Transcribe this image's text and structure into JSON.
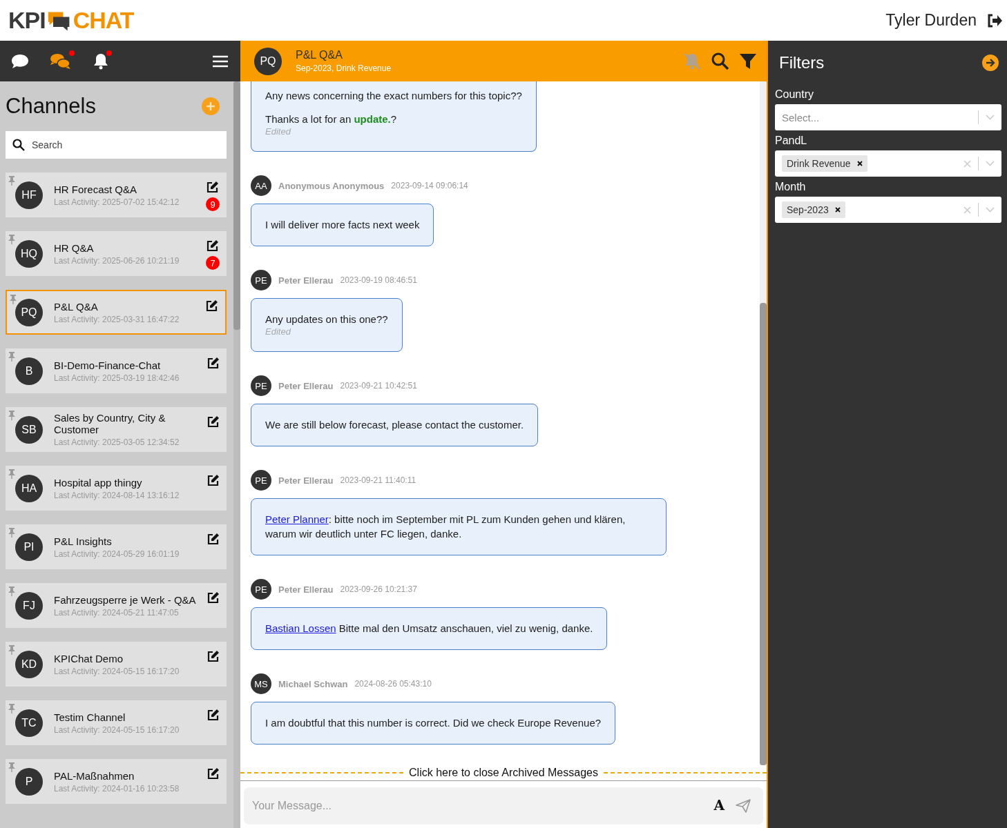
{
  "app": {
    "logo_left": "KPI",
    "logo_right": "CHAT",
    "user": "Tyler Durden"
  },
  "nav": [
    {
      "kind": "chat",
      "selected": false,
      "alert": false
    },
    {
      "kind": "chats",
      "selected": true,
      "alert": true
    },
    {
      "kind": "bell",
      "selected": false,
      "alert": true
    }
  ],
  "channels_title": "Channels",
  "search": {
    "placeholder": "Search"
  },
  "channels": [
    {
      "initials": "HF",
      "name": "HR Forecast Q&A",
      "activity": "Last Activity: 2025-07-02 15:42:12",
      "unread": "9",
      "selected": false
    },
    {
      "initials": "HQ",
      "name": "HR Q&A",
      "activity": "Last Activity: 2025-06-26 10:21:19",
      "unread": "7",
      "selected": false
    },
    {
      "initials": "PQ",
      "name": "P&L Q&A",
      "activity": "Last Activity: 2025-03-31 16:47:22",
      "selected": true
    },
    {
      "initials": "B",
      "name": "BI-Demo-Finance-Chat",
      "activity": "Last Activity: 2025-03-19 18:42:46",
      "selected": false
    },
    {
      "initials": "SB",
      "name": "Sales by Country, City & Customer",
      "activity": "Last Activity: 2025-03-05 12:34:52",
      "selected": false
    },
    {
      "initials": "HA",
      "name": "Hospital app thingy",
      "activity": "Last Activity: 2024-08-14 13:16:12",
      "selected": false
    },
    {
      "initials": "PI",
      "name": "P&L Insights",
      "activity": "Last Activity: 2024-05-29 16:01:19",
      "selected": false
    },
    {
      "initials": "FJ",
      "name": "Fahrzeugsperre je Werk - Q&A",
      "activity": "Last Activity: 2024-05-21 11:47:05",
      "selected": false
    },
    {
      "initials": "KD",
      "name": "KPIChat Demo",
      "activity": "Last Activity: 2024-05-15 16:17:20",
      "selected": false
    },
    {
      "initials": "TC",
      "name": "Testim Channel",
      "activity": "Last Activity: 2024-05-15 16:17:20",
      "selected": false
    },
    {
      "initials": "P",
      "name": "PAL-Maßnahmen",
      "activity": "Last Activity: 2024-01-16 10:23:58",
      "selected": false
    }
  ],
  "chat": {
    "initials": "PQ",
    "title": "P&L Q&A",
    "subtitle": "Sep-2023, Drink Revenue",
    "muted": true
  },
  "messages": [
    {
      "paragraphs": [
        [
          {
            "kind": "text",
            "text": "Any news concerning the exact numbers for this topic??"
          }
        ],
        [
          {
            "kind": "text",
            "text": "Thanks a lot for an **update.**?"
          }
        ]
      ],
      "edited": "Edited"
    },
    {
      "initials": "AA",
      "author": "Anonymous Anonymous",
      "time": "2023-09-14 09:06:14",
      "paragraphs": [
        [
          {
            "kind": "text",
            "text": "I will deliver more facts next week"
          }
        ]
      ]
    },
    {
      "initials": "PE",
      "author": "Peter Ellerau",
      "time": "2023-09-19 08:46:51",
      "paragraphs": [
        [
          {
            "kind": "text",
            "text": "Any updates on this one??"
          }
        ]
      ],
      "edited": "Edited"
    },
    {
      "initials": "PE",
      "author": "Peter Ellerau",
      "time": "2023-09-21 10:42:51",
      "paragraphs": [
        [
          {
            "kind": "text",
            "text": "We are still below forecast, please contact the customer."
          }
        ]
      ]
    },
    {
      "initials": "PE",
      "author": "Peter Ellerau",
      "time": "2023-09-21 11:40:11",
      "paragraphs": [
        [
          {
            "kind": "mention",
            "text": "Peter Planner"
          },
          {
            "kind": "text",
            "text": ": bitte noch im September mit PL zum Kunden gehen und klären, warum wir deutlich unter FC liegen, danke."
          }
        ]
      ]
    },
    {
      "initials": "PE",
      "author": "Peter Ellerau",
      "time": "2023-09-26 10:21:37",
      "paragraphs": [
        [
          {
            "kind": "mention",
            "text": "Bastian Lossen"
          },
          {
            "kind": "text",
            "text": " Bitte mal den Umsatz anschauen, viel zu wenig, danke."
          }
        ]
      ]
    },
    {
      "initials": "MS",
      "author": "Michael Schwan",
      "time": "2024-08-26 05:43:10",
      "paragraphs": [
        [
          {
            "kind": "text",
            "text": "I am doubtful that this number is correct. Did we check Europe Revenue?"
          }
        ]
      ]
    }
  ],
  "archive_toggle": "Click here to close Archived Messages",
  "composer": {
    "placeholder": "Your Message...",
    "format_key": "A"
  },
  "filters": {
    "title": "Filters",
    "fields": [
      {
        "label": "Country",
        "placeholder": "Select..."
      },
      {
        "label": "PandL",
        "chips": [
          "Drink Revenue"
        ]
      },
      {
        "label": "Month",
        "chips": [
          "Sep-2023"
        ]
      }
    ]
  }
}
